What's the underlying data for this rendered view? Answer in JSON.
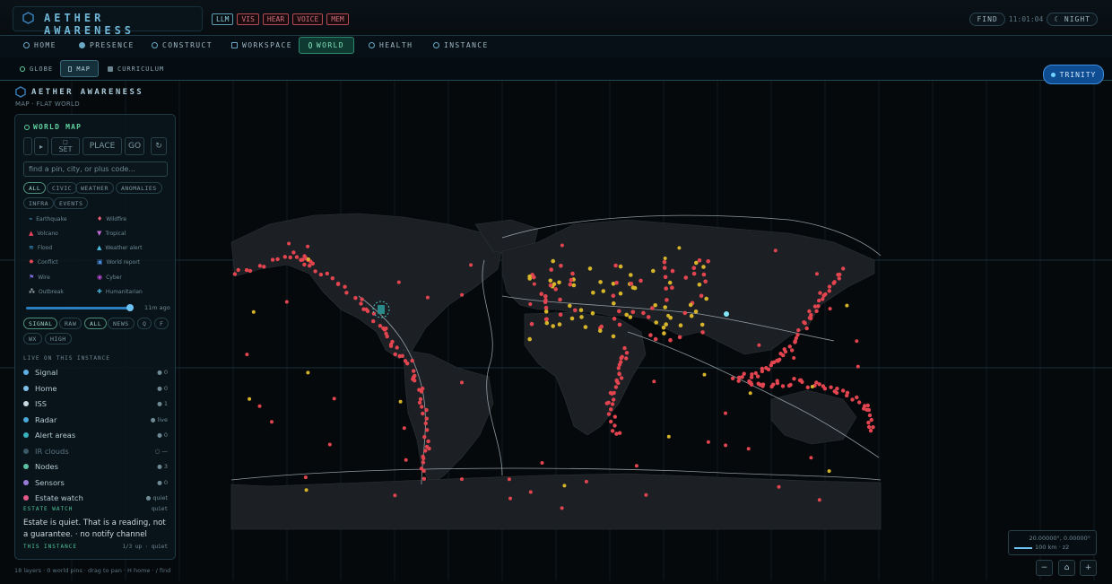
{
  "app": {
    "title": "AETHER AWARENESS",
    "capabilities": [
      "LLM",
      "VIS",
      "HEAR",
      "VOICE",
      "MEM"
    ],
    "find_label": "FIND",
    "clock": "11:01:04",
    "theme_label": "☾ NIGHT"
  },
  "nav": {
    "items": [
      {
        "label": "HOME"
      },
      {
        "label": "PRESENCE"
      },
      {
        "label": "CONSTRUCT"
      },
      {
        "label": "WORKSPACE"
      },
      {
        "label": "WORLD",
        "active": true
      },
      {
        "label": "HEALTH"
      },
      {
        "label": "INSTANCE"
      }
    ]
  },
  "subnav": {
    "items": [
      {
        "label": "GLOBE"
      },
      {
        "label": "MAP",
        "active": true
      },
      {
        "label": "CURRICULUM"
      }
    ]
  },
  "trinity_label": "TRINITY",
  "page": {
    "title": "AETHER AWARENESS",
    "subtitle": "MAP · FLAT WORLD"
  },
  "panel": {
    "title": "WORLD MAP",
    "buttons": {
      "prev": "",
      "play": "▸",
      "set_icon": "□",
      "set": "SET",
      "place": "PLACE",
      "go": "GO",
      "refresh": "↻"
    },
    "search_placeholder": "find a pin, city, or plus code...",
    "filters": [
      "ALL",
      "CIVIC",
      "WEATHER",
      "ANOMALIES",
      "INFRA",
      "EVENTS"
    ],
    "legend": [
      {
        "label": "Earthquake",
        "color": "#4aa3d8",
        "glyph": "⌁"
      },
      {
        "label": "Wildfire",
        "color": "#f0607a",
        "glyph": "♦"
      },
      {
        "label": "Volcano",
        "color": "#e2445c",
        "glyph": "▲"
      },
      {
        "label": "Tropical",
        "color": "#c26ad8",
        "glyph": "▼"
      },
      {
        "label": "Flood",
        "color": "#3fa0d8",
        "glyph": "≋"
      },
      {
        "label": "Weather alert",
        "color": "#4ac0e0",
        "glyph": "▲"
      },
      {
        "label": "Conflict",
        "color": "#f04a5a",
        "glyph": "✸"
      },
      {
        "label": "World report",
        "color": "#4a8ad8",
        "glyph": "▣"
      },
      {
        "label": "Wire",
        "color": "#7a6ad8",
        "glyph": "⚑"
      },
      {
        "label": "Cyber",
        "color": "#c04ad8",
        "glyph": "◉"
      },
      {
        "label": "Outbreak",
        "color": "#c0d0d8",
        "glyph": "⁂"
      },
      {
        "label": "Humanitarian",
        "color": "#4ab0e0",
        "glyph": "✚"
      }
    ],
    "time_window": "11m ago",
    "time_position": 1.0,
    "source_filters": [
      "SIGNAL",
      "RAW",
      "ALL",
      "NEWS",
      "Q",
      "F",
      "WX",
      "HIGH"
    ],
    "live_heading": "LIVE ON THIS INSTANCE",
    "layers": [
      {
        "label": "Signal",
        "value": "● 0",
        "color": "#5fb0e8"
      },
      {
        "label": "Home",
        "value": "● 0",
        "color": "#7fc0e8"
      },
      {
        "label": "ISS",
        "value": "● 1",
        "color": "#c8d8e0"
      },
      {
        "label": "Radar",
        "value": "● live",
        "color": "#4aa8d8"
      },
      {
        "label": "Alert areas",
        "value": "● 0",
        "color": "#3ab0c0"
      },
      {
        "label": "IR clouds",
        "value": "○ —",
        "color": "#3a5866",
        "dim": true
      },
      {
        "label": "Nodes",
        "value": "● 3",
        "color": "#5ac0a0"
      },
      {
        "label": "Sensors",
        "value": "● 0",
        "color": "#9a7ad8"
      },
      {
        "label": "Estate watch",
        "value": "● quiet",
        "color": "#e25a8a"
      }
    ],
    "estate_heading": "ESTATE WATCH",
    "estate_state": "quiet",
    "estate_note": "Estate is quiet. That is a reading, not a guarantee. · no notify channel",
    "instance_heading": "THIS INSTANCE",
    "instance_state": "1/3 up · quiet"
  },
  "footer": "18 layers · 0 world pins · drag to pan · H home · / find",
  "map_readout": {
    "coords": "20.00000°, 0.00000°",
    "scale": "100 km · z2"
  },
  "zoom": {
    "out": "−",
    "home": "⌂",
    "in": "+"
  },
  "colors": {
    "accent": "#5fd3a0",
    "event_red": "#e2454f",
    "event_yellow": "#d6b42a",
    "land": "#1c2024"
  }
}
